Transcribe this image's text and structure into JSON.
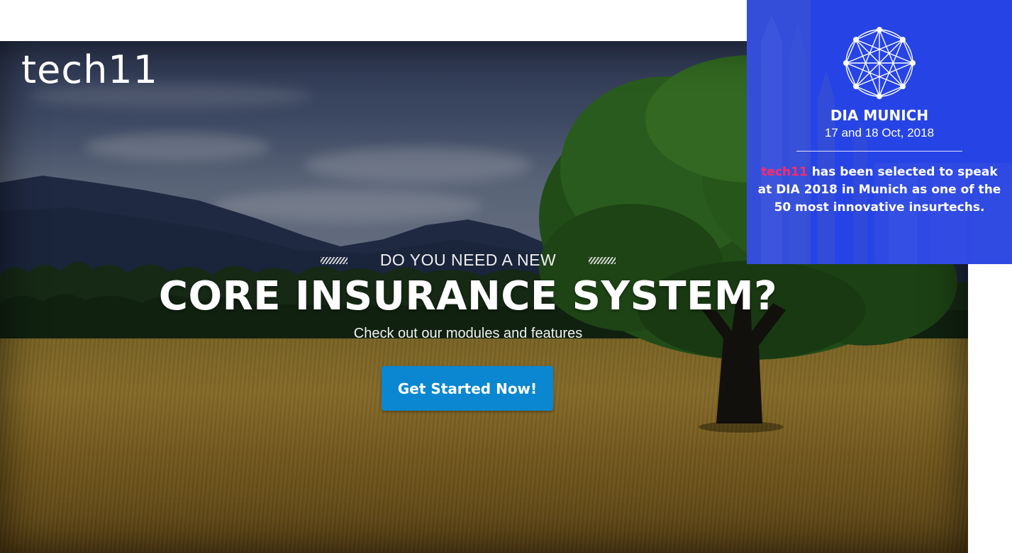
{
  "site": {
    "logo_text": "tech11"
  },
  "hero": {
    "eyebrow": "DO YOU NEED A NEW",
    "headline": "CORE INSURANCE SYSTEM?",
    "subheadline": "Check out our modules and features",
    "cta_label": "Get Started Now!"
  },
  "promo": {
    "title": "DIA MUNICH",
    "date": "17 and 18 Oct, 2018",
    "brand": "tech11",
    "body": " has been selected to speak at DIA 2018 in Munich as one of the 50 most innovative insurtechs."
  },
  "colors": {
    "cta_background": "#0a87d0",
    "promo_background": "#1e3ceb",
    "promo_brand": "#ff2a6a"
  }
}
